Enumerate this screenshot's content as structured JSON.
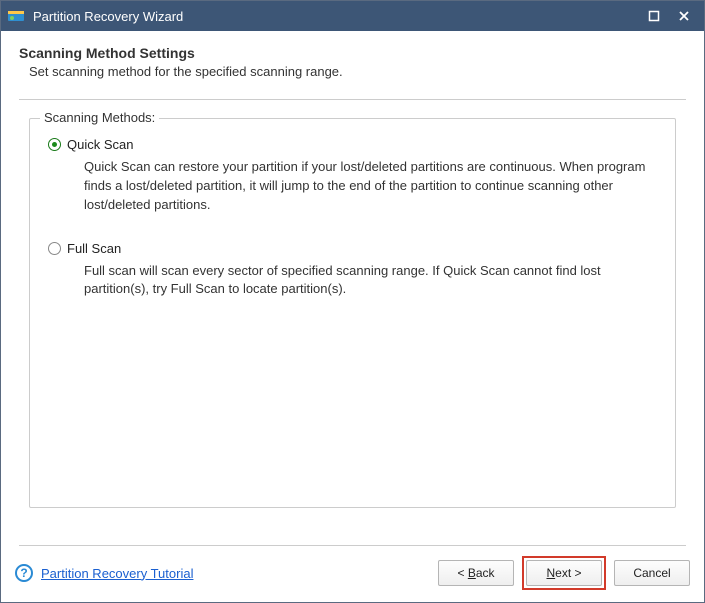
{
  "titlebar": {
    "title": "Partition Recovery Wizard"
  },
  "header": {
    "title": "Scanning Method Settings",
    "subtitle": "Set scanning method for the specified scanning range."
  },
  "fieldset": {
    "legend": "Scanning Methods:"
  },
  "options": {
    "quick": {
      "label": "Quick Scan",
      "checked": true,
      "desc": "Quick Scan can restore your partition if your lost/deleted partitions are continuous. When program finds a lost/deleted partition, it will jump to the end of the partition to continue scanning other lost/deleted partitions."
    },
    "full": {
      "label": "Full Scan",
      "checked": false,
      "desc": "Full scan will scan every sector of specified scanning range. If Quick Scan cannot find lost partition(s), try Full Scan to locate partition(s)."
    }
  },
  "footer": {
    "help_link": "Partition Recovery Tutorial",
    "back_u": "B",
    "back_rest": "ack",
    "next_u": "N",
    "next_rest": "ext >",
    "cancel": "Cancel"
  }
}
